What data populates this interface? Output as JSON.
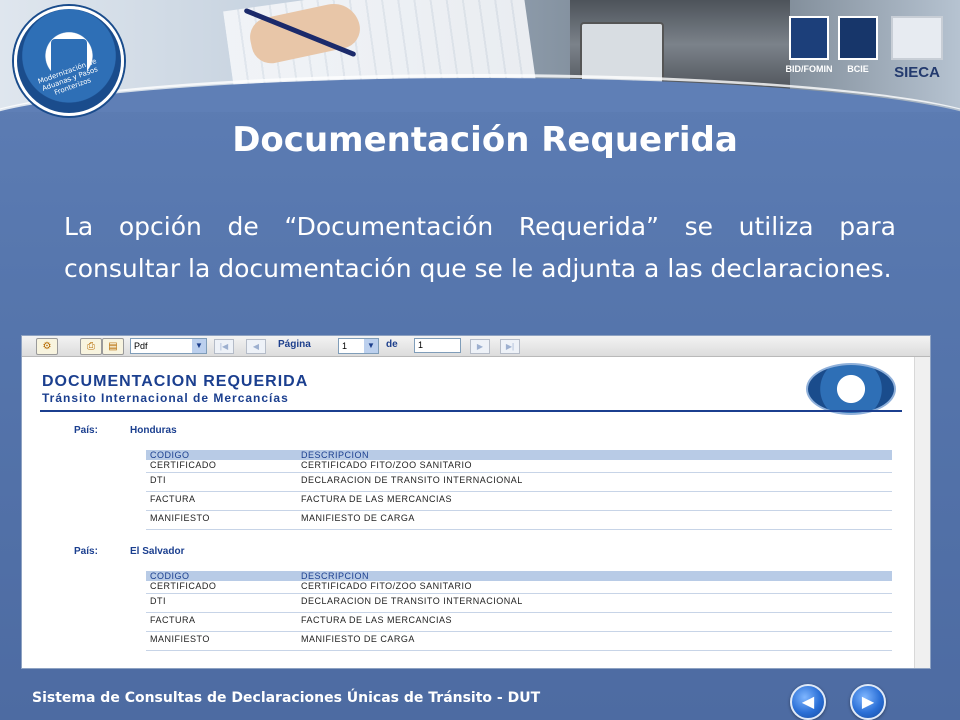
{
  "slide": {
    "title": "Documentación Requerida",
    "body": "La opción de “Documentación Requerida” se utiliza para consultar la documentación que se le adjunta a las declaraciones.",
    "footer": "Sistema de Consultas de Declaraciones Únicas de Tránsito - DUT"
  },
  "header": {
    "logo_text": "Modernización de Aduanas y Pasos Fronterizos",
    "partners": [
      {
        "name": "BID/FOMIN",
        "icon": "bid-fomin-logo"
      },
      {
        "name": "BCIE",
        "icon": "bcie-logo"
      },
      {
        "name": "SIECA",
        "icon": "sieca-logo"
      }
    ]
  },
  "toolbar": {
    "export_format": "Pdf",
    "page_label": "Página",
    "page_value": "1",
    "of_label": "de",
    "total_pages": "1"
  },
  "report": {
    "title": "DOCUMENTACION REQUERIDA",
    "subtitle": "Tránsito Internacional de Mercancías",
    "country_label": "País:",
    "col_code": "CODIGO",
    "col_desc": "DESCRIPCION",
    "groups": [
      {
        "country": "Honduras",
        "rows": [
          {
            "code": "CERTIFICADO",
            "desc": "CERTIFICADO FITO/ZOO SANITARIO"
          },
          {
            "code": "DTI",
            "desc": "DECLARACION DE TRANSITO INTERNACIONAL"
          },
          {
            "code": "FACTURA",
            "desc": "FACTURA DE LAS MERCANCIAS"
          },
          {
            "code": "MANIFIESTO",
            "desc": "MANIFIESTO DE CARGA"
          }
        ]
      },
      {
        "country": "El Salvador",
        "rows": [
          {
            "code": "CERTIFICADO",
            "desc": "CERTIFICADO FITO/ZOO SANITARIO"
          },
          {
            "code": "DTI",
            "desc": "DECLARACION DE TRANSITO INTERNACIONAL"
          },
          {
            "code": "FACTURA",
            "desc": "FACTURA DE LAS MERCANCIAS"
          },
          {
            "code": "MANIFIESTO",
            "desc": "MANIFIESTO DE CARGA"
          }
        ]
      }
    ]
  },
  "nav": {
    "prev_icon": "triangle-left-icon",
    "next_icon": "triangle-right-icon"
  }
}
